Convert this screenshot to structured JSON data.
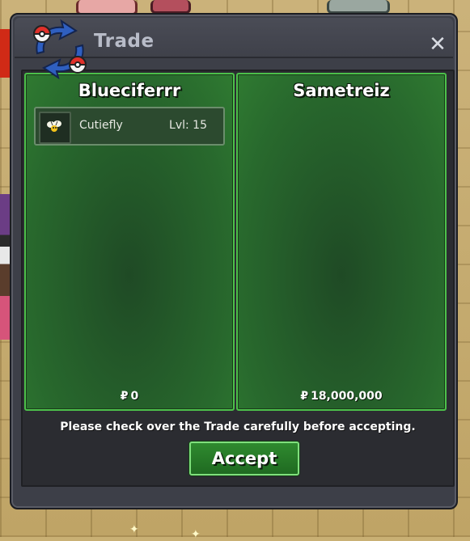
{
  "window": {
    "title": "Trade",
    "close_label": "✕"
  },
  "left_player": {
    "name": "Blueciferrr",
    "pokemon": [
      {
        "name": "Cutiefly",
        "level": "Lvl: 15",
        "icon": "cutiefly-icon"
      }
    ],
    "currency_symbol": "₽",
    "money": "0"
  },
  "right_player": {
    "name": "Sametreiz",
    "pokemon": [],
    "currency_symbol": "₽",
    "money": "18,000,000"
  },
  "notice": "Please check over the Trade carefully before accepting.",
  "accept_label": "Accept",
  "colors": {
    "panel_border": "#4cc04a",
    "panel_fill": "#28692d",
    "window_bg": "#3d3f48",
    "button": "#2f8a2f"
  }
}
